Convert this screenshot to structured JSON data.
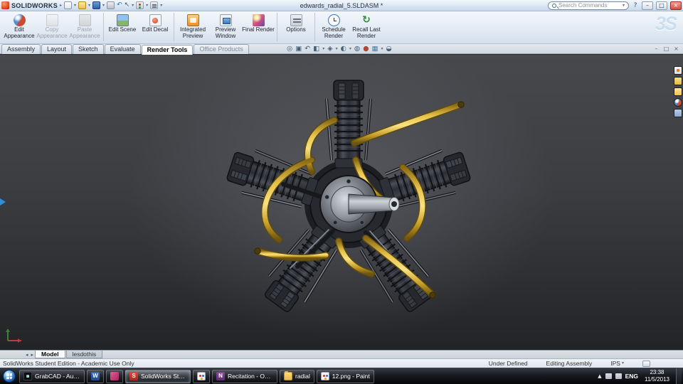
{
  "glyphs": {
    "caret": "▾",
    "tray_arrow": "▲",
    "tab_prev": "◂",
    "tab_next": "▸",
    "help": "?",
    "minimize": "–",
    "maximize": "□",
    "close": "×",
    "logo_arrow": "▸",
    "undo": "↶",
    "cursor": "↖",
    "recall": "↻"
  },
  "titlebar": {
    "logo_text": "SOLIDWORKS",
    "doc_title": "edwards_radial_5.SLDASM *",
    "search_placeholder": "Search Commands"
  },
  "ribbon": {
    "ds_logo": "3S",
    "buttons": [
      {
        "label": "Edit Appearance",
        "disabled": false
      },
      {
        "label": "Copy Appearance",
        "disabled": true
      },
      {
        "label": "Paste Appearance",
        "disabled": true
      },
      {
        "label": "Edit Scene",
        "disabled": false
      },
      {
        "label": "Edit Decal",
        "disabled": false
      },
      {
        "label": "Integrated Preview",
        "disabled": false
      },
      {
        "label": "Preview Window",
        "disabled": false
      },
      {
        "label": "Final Render",
        "disabled": false
      },
      {
        "label": "Options",
        "disabled": false
      },
      {
        "label": "Schedule Render",
        "disabled": false
      },
      {
        "label": "Recall Last Render",
        "disabled": false
      }
    ]
  },
  "command_tabs": {
    "items": [
      {
        "label": "Assembly",
        "active": false
      },
      {
        "label": "Layout",
        "active": false
      },
      {
        "label": "Sketch",
        "active": false
      },
      {
        "label": "Evaluate",
        "active": false
      },
      {
        "label": "Render Tools",
        "active": true
      },
      {
        "label": "Office Products",
        "active": false
      }
    ]
  },
  "headsup": {
    "icons": [
      {
        "name": "zoom-fit-icon",
        "glyph": "◎"
      },
      {
        "name": "zoom-area-icon",
        "glyph": "▣"
      },
      {
        "name": "previous-view-icon",
        "glyph": "↶"
      },
      {
        "name": "section-view-icon",
        "glyph": "◧"
      },
      {
        "name": "view-orientation-icon",
        "glyph": "◈"
      },
      {
        "name": "display-style-icon",
        "glyph": "◐"
      },
      {
        "name": "hide-show-icon",
        "glyph": "◍"
      },
      {
        "name": "edit-appearance-icon",
        "glyph": "●"
      },
      {
        "name": "apply-scene-icon",
        "glyph": "▦"
      },
      {
        "name": "view-settings-icon",
        "glyph": "◒"
      }
    ]
  },
  "viewport_window": {
    "minimize": "–",
    "restore": "□",
    "close": "×"
  },
  "model_tabs": {
    "items": [
      {
        "label": "Model",
        "active": true
      },
      {
        "label": "lesdothis",
        "active": false
      }
    ]
  },
  "statusbar": {
    "left_text": "SolidWorks Student Edition - Academic Use Only",
    "constraint_status": "Under Defined",
    "mode": "Editing Assembly",
    "units": "IPS"
  },
  "taskbar": {
    "items": [
      {
        "label": "GrabCAD - Aurora",
        "icon": "grabcad",
        "active": false
      },
      {
        "label": "",
        "icon": "word",
        "letter": "W",
        "active": false
      },
      {
        "label": "",
        "icon": "app-pink",
        "active": false
      },
      {
        "label": "SolidWorks Stud...",
        "icon": "solidworks",
        "letter": "S",
        "active": true
      },
      {
        "label": "",
        "icon": "paint",
        "active": false
      },
      {
        "label": "Recitation - One...",
        "icon": "onenote",
        "letter": "N",
        "active": false
      },
      {
        "label": "radial",
        "icon": "folder",
        "active": false
      },
      {
        "label": "12.png - Paint",
        "icon": "paint",
        "active": false
      }
    ],
    "tray": {
      "language": "ENG",
      "time": "23:38",
      "date": "11/5/2013"
    }
  }
}
